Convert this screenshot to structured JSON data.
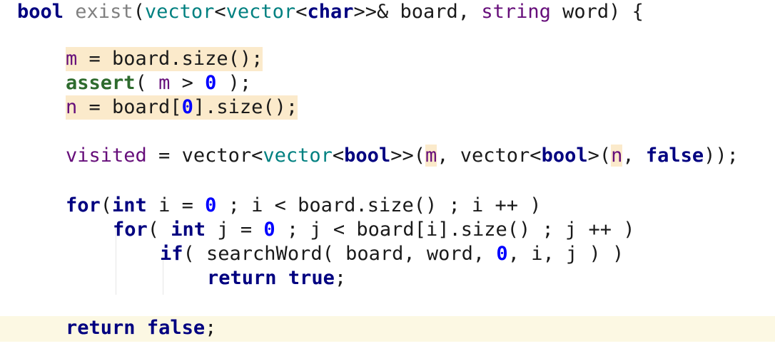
{
  "editor": {
    "colors": {
      "keyword": "#000080",
      "type": "#008080",
      "field": "#660e7a",
      "number": "#0000ff",
      "highlight": "#fbeacb",
      "current_line": "#fcf8e3"
    },
    "lines": [
      {
        "id": "signature",
        "tokens": [
          {
            "text": "bool",
            "kind": "kw"
          },
          {
            "text": " ",
            "kind": "t"
          },
          {
            "text": "exist",
            "kind": "fn"
          },
          {
            "text": "(",
            "kind": "t"
          },
          {
            "text": "vector",
            "kind": "type"
          },
          {
            "text": "<",
            "kind": "t"
          },
          {
            "text": "vector",
            "kind": "type"
          },
          {
            "text": "<",
            "kind": "t"
          },
          {
            "text": "char",
            "kind": "kw"
          },
          {
            "text": ">>& board, ",
            "kind": "t"
          },
          {
            "text": "string",
            "kind": "field"
          },
          {
            "text": " word) {",
            "kind": "t"
          }
        ]
      },
      {
        "id": "assign-m",
        "tokens": [
          {
            "text": "m",
            "kind": "field"
          },
          {
            "text": " = board.size();",
            "kind": "t"
          }
        ]
      },
      {
        "id": "assert",
        "tokens": [
          {
            "text": "assert",
            "kind": "kwgreen"
          },
          {
            "text": "( ",
            "kind": "t"
          },
          {
            "text": "m",
            "kind": "field"
          },
          {
            "text": " > ",
            "kind": "t"
          },
          {
            "text": "0",
            "kind": "num"
          },
          {
            "text": " );",
            "kind": "t"
          }
        ]
      },
      {
        "id": "assign-n",
        "tokens": [
          {
            "text": "n",
            "kind": "field"
          },
          {
            "text": " = board[",
            "kind": "t"
          },
          {
            "text": "0",
            "kind": "num"
          },
          {
            "text": "].size();",
            "kind": "t"
          }
        ]
      },
      {
        "id": "visited",
        "tokens": [
          {
            "text": "visited",
            "kind": "field"
          },
          {
            "text": " = vector<",
            "kind": "t"
          },
          {
            "text": "vector",
            "kind": "type"
          },
          {
            "text": "<",
            "kind": "t"
          },
          {
            "text": "bool",
            "kind": "kw"
          },
          {
            "text": ">>(",
            "kind": "t"
          },
          {
            "text": "m",
            "kind": "field"
          },
          {
            "text": ", vector<",
            "kind": "t"
          },
          {
            "text": "bool",
            "kind": "kw"
          },
          {
            "text": ">(",
            "kind": "t"
          },
          {
            "text": "n",
            "kind": "field"
          },
          {
            "text": ", ",
            "kind": "t"
          },
          {
            "text": "false",
            "kind": "kw"
          },
          {
            "text": "));",
            "kind": "t"
          }
        ]
      },
      {
        "id": "for-i",
        "tokens": [
          {
            "text": "for",
            "kind": "kw"
          },
          {
            "text": "(",
            "kind": "t"
          },
          {
            "text": "int",
            "kind": "kw"
          },
          {
            "text": " i = ",
            "kind": "t"
          },
          {
            "text": "0",
            "kind": "num"
          },
          {
            "text": " ; i < board.size() ; i ++ )",
            "kind": "t"
          }
        ]
      },
      {
        "id": "for-j",
        "tokens": [
          {
            "text": "for",
            "kind": "kw"
          },
          {
            "text": "( ",
            "kind": "t"
          },
          {
            "text": "int",
            "kind": "kw"
          },
          {
            "text": " j = ",
            "kind": "t"
          },
          {
            "text": "0",
            "kind": "num"
          },
          {
            "text": " ; j < board[i].size() ; j ++ )",
            "kind": "t"
          }
        ]
      },
      {
        "id": "if-search",
        "tokens": [
          {
            "text": "if",
            "kind": "kw"
          },
          {
            "text": "( searchWord( board, word, ",
            "kind": "t"
          },
          {
            "text": "0",
            "kind": "num"
          },
          {
            "text": ", i, j ) )",
            "kind": "t"
          }
        ]
      },
      {
        "id": "return-true",
        "tokens": [
          {
            "text": "return",
            "kind": "kw"
          },
          {
            "text": " ",
            "kind": "t"
          },
          {
            "text": "true",
            "kind": "kw"
          },
          {
            "text": ";",
            "kind": "t"
          }
        ]
      },
      {
        "id": "return-false",
        "tokens": [
          {
            "text": "return",
            "kind": "kw"
          },
          {
            "text": " ",
            "kind": "t"
          },
          {
            "text": "false",
            "kind": "kw"
          },
          {
            "text": ";",
            "kind": "t"
          }
        ]
      }
    ]
  }
}
